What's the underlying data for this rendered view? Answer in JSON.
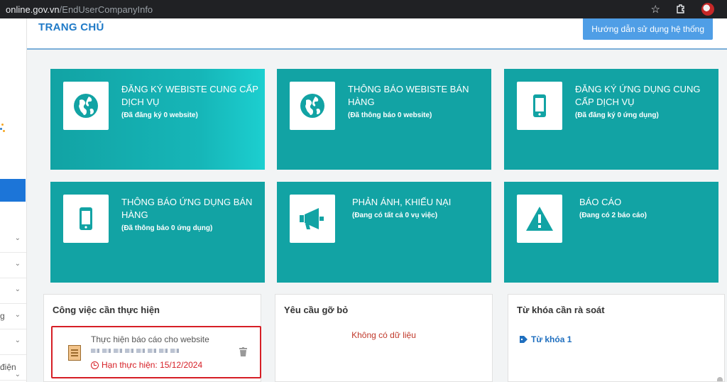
{
  "browser": {
    "url_host": "online.gov.vn",
    "url_path": "/EndUserCompanyInfo"
  },
  "sidebar": {
    "fragments": [
      "",
      "",
      "",
      "g",
      "",
      "điện"
    ]
  },
  "header": {
    "title": "TRANG CHỦ",
    "guide_button": "Hướng dẫn sử dụng hệ thống"
  },
  "tiles": [
    {
      "title": "ĐĂNG KÝ WEBISTE CUNG CẤP DỊCH VỤ",
      "subtitle": "(Đã đăng ký 0 website)",
      "icon": "globe-icon"
    },
    {
      "title": "THÔNG BÁO WEBISTE BÁN HÀNG",
      "subtitle": "(Đã thông báo 0 website)",
      "icon": "globe-icon"
    },
    {
      "title": "ĐĂNG KÝ ỨNG DỤNG CUNG CẤP DỊCH VỤ",
      "subtitle": "(Đã đăng ký 0 ứng dụng)",
      "icon": "mobile-icon"
    },
    {
      "title": "THÔNG BÁO ỨNG DỤNG BÁN HÀNG",
      "subtitle": "(Đã thông báo 0 ứng dụng)",
      "icon": "mobile-icon"
    },
    {
      "title": "PHẢN ÁNH, KHIẾU NẠI",
      "subtitle": "(Đang có tất cả 0 vụ việc)",
      "icon": "megaphone-icon"
    },
    {
      "title": "BÁO CÁO",
      "subtitle": "(Đang có 2 báo cáo)",
      "icon": "warning-icon"
    }
  ],
  "panels": {
    "tasks": {
      "title": "Công việc cần thực hiện",
      "item_title": "Thực hiện báo cáo cho website",
      "deadline": "Hạn thực hiện: 15/12/2024"
    },
    "removal": {
      "title": "Yêu cầu gỡ bỏ",
      "empty": "Không có dữ liệu"
    },
    "keywords": {
      "title": "Từ khóa cần rà soát",
      "item": "Từ khóa 1"
    }
  },
  "colors": {
    "tile": "#12a3a4",
    "accent": "#1f7ac7",
    "alert": "#d61f26"
  }
}
